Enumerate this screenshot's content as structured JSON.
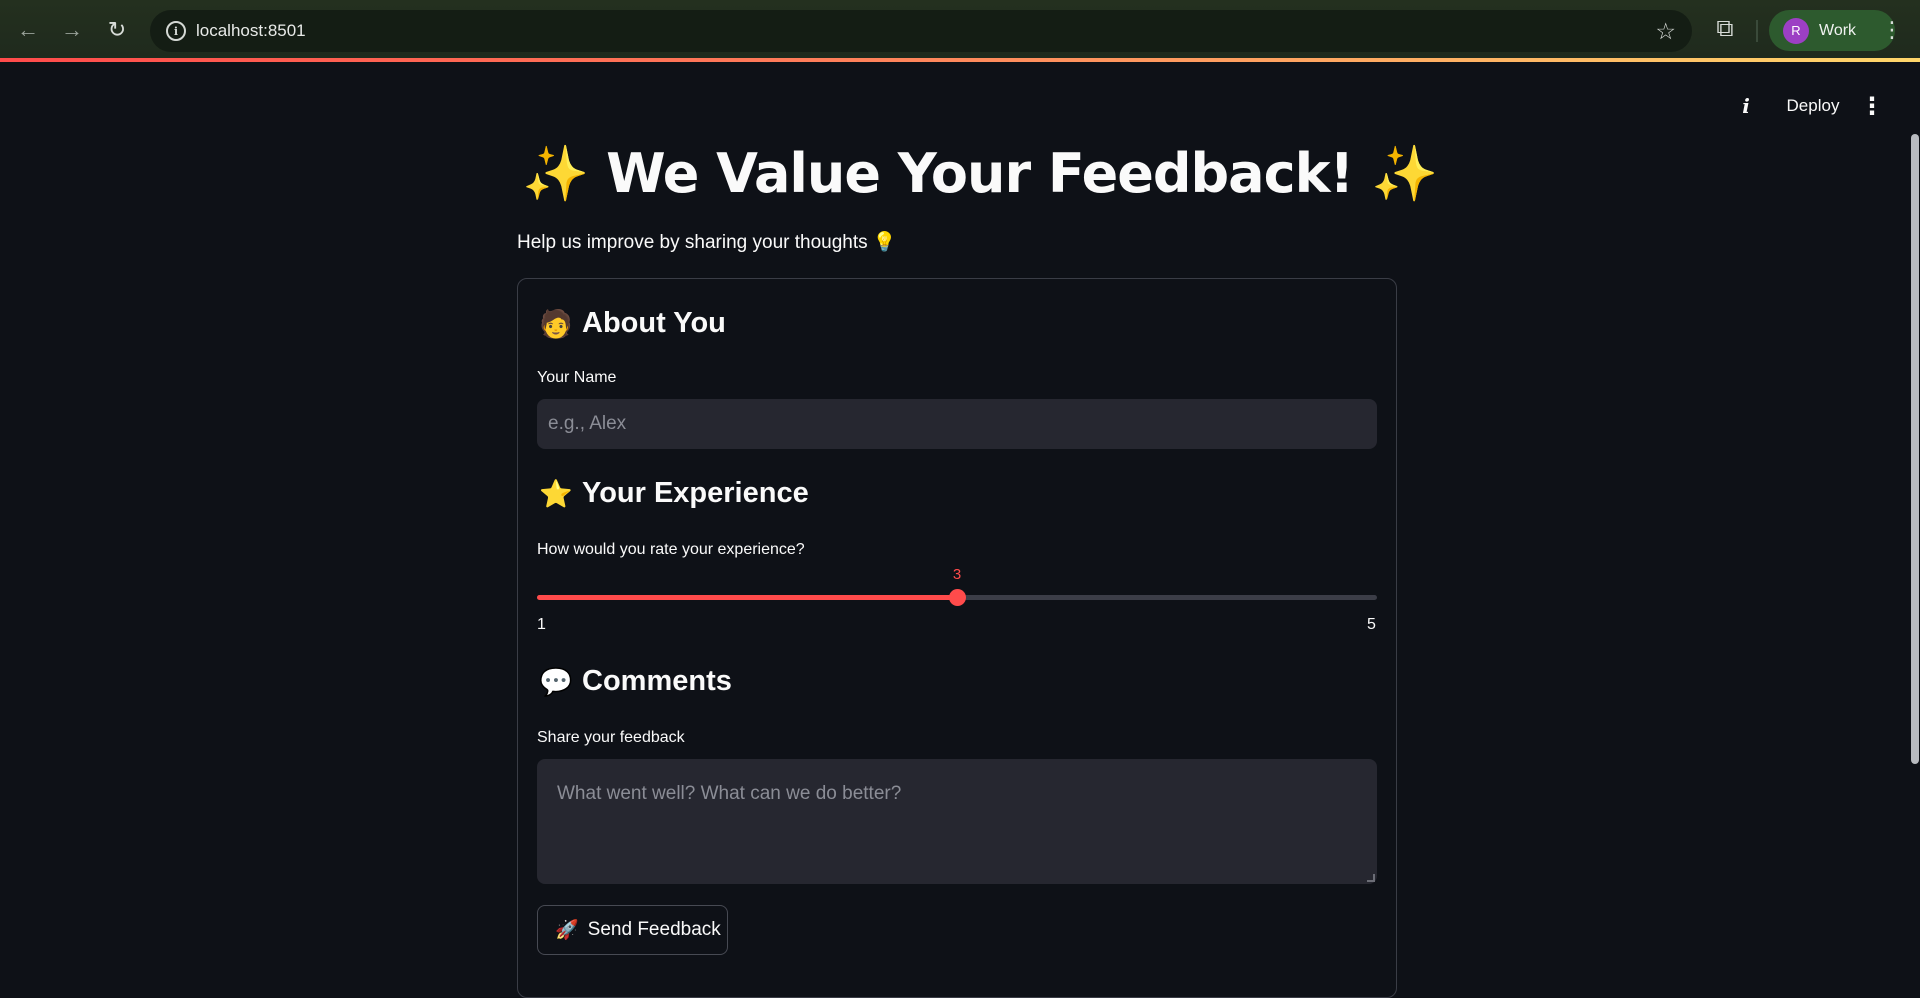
{
  "browser": {
    "url": "localhost:8501",
    "profile_initial": "R",
    "profile_name": "Work",
    "back_glyph": "←",
    "forward_glyph": "→",
    "reload_glyph": "↻",
    "info_glyph": "i",
    "star_glyph": "☆",
    "extensions_glyph": "⧉",
    "menu_glyph": "⋮"
  },
  "toolbar": {
    "info_glyph": "i",
    "deploy_label": "Deploy",
    "menu_glyph": "⋮"
  },
  "page": {
    "title_icon_left": "✨",
    "title": "We Value Your Feedback!",
    "title_icon_right": "✨",
    "subtitle": "Help us improve by sharing your thoughts",
    "subtitle_icon": "💡"
  },
  "form": {
    "about": {
      "icon": "🧑",
      "heading": "About You",
      "name_label": "Your Name",
      "name_placeholder": "e.g., Alex",
      "name_value": ""
    },
    "experience": {
      "icon": "⭐",
      "heading": "Your Experience",
      "rating_label": "How would you rate your experience?",
      "rating_value": "3",
      "rating_min": "1",
      "rating_max": "5"
    },
    "comments": {
      "icon": "💬",
      "heading": "Comments",
      "feedback_label": "Share your feedback",
      "feedback_placeholder": "What went well? What can we do better?",
      "feedback_value": ""
    },
    "submit": {
      "icon": "🚀",
      "label": "Send Feedback"
    }
  },
  "colors": {
    "background": "#0e1117",
    "accent": "#ff4b4b",
    "input_bg": "#262730"
  }
}
